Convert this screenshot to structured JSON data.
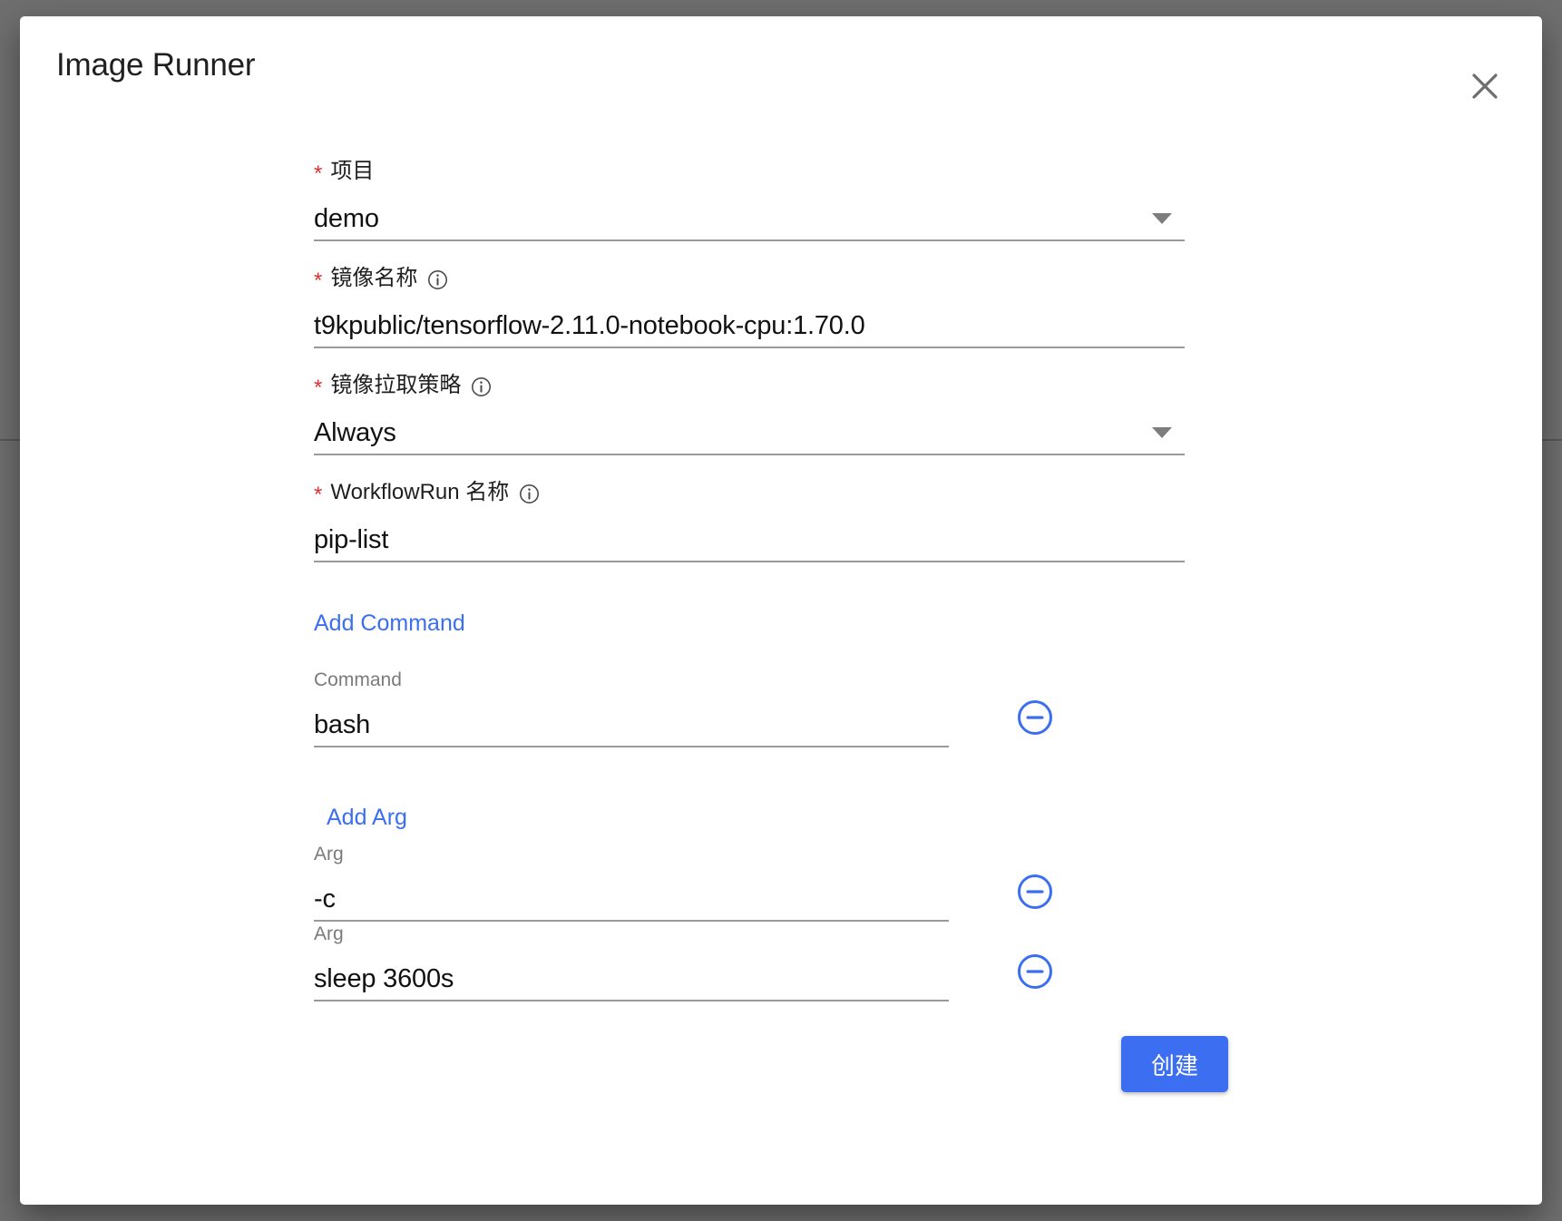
{
  "dialog": {
    "title": "Image Runner",
    "close_icon": "close-icon"
  },
  "form": {
    "fields": [
      {
        "label": "项目",
        "required_marker": "*",
        "has_info_icon": false,
        "value": "demo",
        "type": "select",
        "caret_icon": "chevron-down-icon"
      },
      {
        "label": "镜像名称",
        "required_marker": "*",
        "has_info_icon": true,
        "value": "t9kpublic/tensorflow-2.11.0-notebook-cpu:1.70.0",
        "type": "text"
      },
      {
        "label": "镜像拉取策略",
        "required_marker": "*",
        "has_info_icon": true,
        "value": "Always",
        "type": "select",
        "caret_icon": "chevron-down-icon"
      },
      {
        "label": "WorkflowRun 名称",
        "required_marker": "*",
        "has_info_icon": true,
        "value": "pip-list",
        "type": "text"
      }
    ]
  },
  "command_section": {
    "add_link": "Add Command",
    "item_label": "Command",
    "remove_icon": "minus-circle-icon",
    "items": [
      {
        "label": "Command",
        "value": "bash"
      }
    ]
  },
  "arg_section": {
    "add_link": "Add Arg",
    "item_label": "Arg",
    "remove_icon": "minus-circle-icon",
    "items": [
      {
        "label": "Arg",
        "value": "-c"
      },
      {
        "label": "Arg",
        "value": "sleep 3600s"
      }
    ]
  },
  "footer": {
    "submit_label": "创建"
  },
  "colors": {
    "accent": "#3b6ef0",
    "required": "#e03131",
    "backdrop": "#6e6e6e",
    "underline": "#9a9a9a",
    "sub_label": "#7b7b7b"
  }
}
